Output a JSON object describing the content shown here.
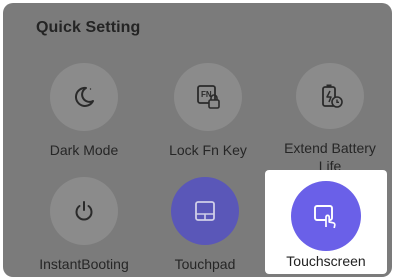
{
  "panel": {
    "title": "Quick Setting"
  },
  "tiles": [
    {
      "label": "Dark Mode",
      "icon": "moon-icon",
      "active": false
    },
    {
      "label": "Lock Fn Key",
      "icon": "fn-lock-icon",
      "active": false
    },
    {
      "label": "Extend Battery Life",
      "label_line1": "Extend Battery",
      "label_line2": "Life",
      "icon": "battery-clock-icon",
      "active": false
    },
    {
      "label": "InstantBooting",
      "icon": "power-icon",
      "active": false
    },
    {
      "label": "Touchpad",
      "icon": "touchpad-icon",
      "active": true
    },
    {
      "label": "Touchscreen",
      "icon": "touchscreen-icon",
      "active": true,
      "highlighted": true
    }
  ],
  "colors": {
    "panel_bg": "#7b7b7b",
    "tile_bg": "#8b8b8b",
    "active_dim": "#5a57b8",
    "active_bright": "#6a60e8",
    "highlight_bg": "#ffffff"
  }
}
